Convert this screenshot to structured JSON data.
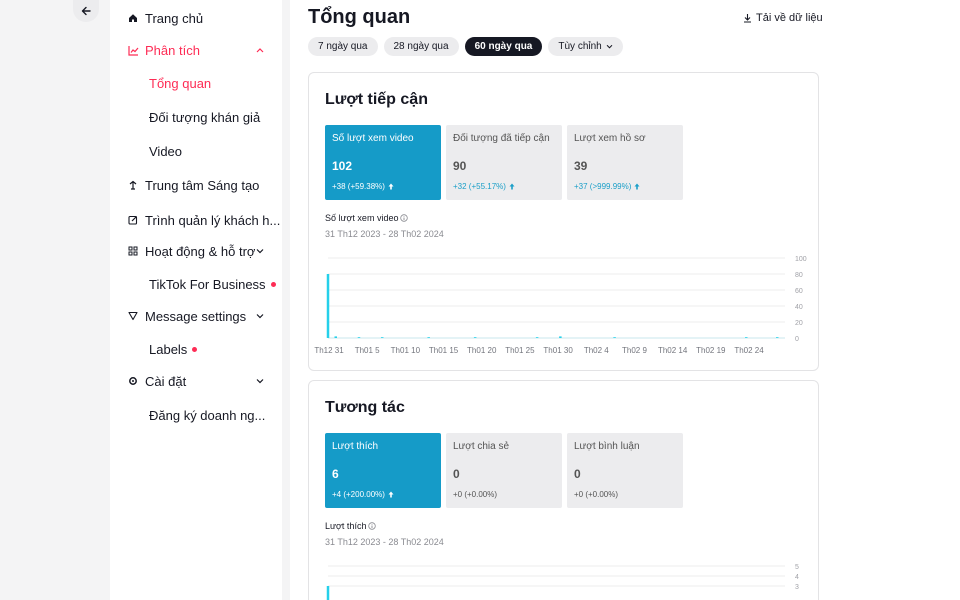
{
  "colors": {
    "accent_red": "#fe2c55",
    "accent_blue": "#159bc8",
    "line": "#25d0ea"
  },
  "sidebar": {
    "back_icon": "arrow-left-icon",
    "items": [
      {
        "label": "Trang chủ",
        "icon": "home-icon"
      },
      {
        "label": "Phân tích",
        "icon": "chart-icon",
        "expanded": true
      },
      {
        "label": "Tổng quan"
      },
      {
        "label": "Đối tượng khán giả"
      },
      {
        "label": "Video"
      },
      {
        "label": "Trung tâm Sáng tạo",
        "icon": "lightbulb-icon"
      },
      {
        "label": "Trình quản lý khách h...",
        "icon": "edit-icon"
      },
      {
        "label": "Hoạt động & hỗ trợ",
        "icon": "grid-icon"
      },
      {
        "label": "TikTok For Business"
      },
      {
        "label": "Message settings",
        "icon": "filter-icon"
      },
      {
        "label": "Labels"
      },
      {
        "label": "Cài đặt",
        "icon": "gear-icon"
      },
      {
        "label": "Đăng ký doanh ng..."
      }
    ]
  },
  "header": {
    "title": "Tổng quan",
    "download_label": "Tải về dữ liệu",
    "ranges": [
      "7 ngày qua",
      "28 ngày qua",
      "60 ngày qua",
      "Tùy chỉnh"
    ],
    "selected_range": "60 ngày qua"
  },
  "reach": {
    "title": "Lượt tiếp cận",
    "metrics": [
      {
        "label": "Số lượt xem video",
        "value": "102",
        "delta": "+38 (+59.38%)"
      },
      {
        "label": "Đối tượng đã tiếp cận",
        "value": "90",
        "delta": "+32 (+55.17%)"
      },
      {
        "label": "Lượt xem hồ sơ",
        "value": "39",
        "delta": "+37 (>999.99%)"
      }
    ],
    "chart_label": "Số lượt xem video",
    "chart_range": "31 Th12 2023 - 28 Th02 2024"
  },
  "engagement": {
    "title": "Tương tác",
    "metrics": [
      {
        "label": "Lượt thích",
        "value": "6",
        "delta": "+4 (+200.00%)"
      },
      {
        "label": "Lượt chia sẻ",
        "value": "0",
        "delta": "+0 (+0.00%)"
      },
      {
        "label": "Lượt bình luận",
        "value": "0",
        "delta": "+0 (+0.00%)"
      }
    ],
    "chart_label": "Lượt thích",
    "chart_range": "31 Th12 2023 - 28 Th02 2024"
  },
  "chart_data": [
    {
      "type": "line",
      "categories": [
        "Th12 31",
        "Th01 5",
        "Th01 10",
        "Th01 15",
        "Th01 20",
        "Th01 25",
        "Th01 30",
        "Th02 4",
        "Th02 9",
        "Th02 14",
        "Th02 19",
        "Th02 24"
      ],
      "yticks": [
        "100",
        "80",
        "60",
        "40",
        "20",
        "0"
      ],
      "ylim": [
        0,
        100
      ],
      "grid": true,
      "x_start": "2023-12-31",
      "x_end": "2024-02-28",
      "points": [
        {
          "date": "2023-12-31",
          "value": 80
        },
        {
          "date": "2024-01-01",
          "value": 2
        },
        {
          "date": "2024-01-04",
          "value": 1
        },
        {
          "date": "2024-01-07",
          "value": 1
        },
        {
          "date": "2024-01-13",
          "value": 1
        },
        {
          "date": "2024-01-19",
          "value": 1
        },
        {
          "date": "2024-01-27",
          "value": 1
        },
        {
          "date": "2024-01-30",
          "value": 2
        },
        {
          "date": "2024-02-06",
          "value": 1
        },
        {
          "date": "2024-02-23",
          "value": 1
        },
        {
          "date": "2024-02-27",
          "value": 1
        }
      ]
    },
    {
      "type": "line",
      "yticks": [
        "5",
        "4",
        "3"
      ],
      "ylim": [
        0,
        5
      ],
      "grid": true,
      "x_start": "2023-12-31",
      "x_end": "2024-02-28",
      "points": [
        {
          "date": "2023-12-31",
          "value": 3
        }
      ]
    }
  ]
}
